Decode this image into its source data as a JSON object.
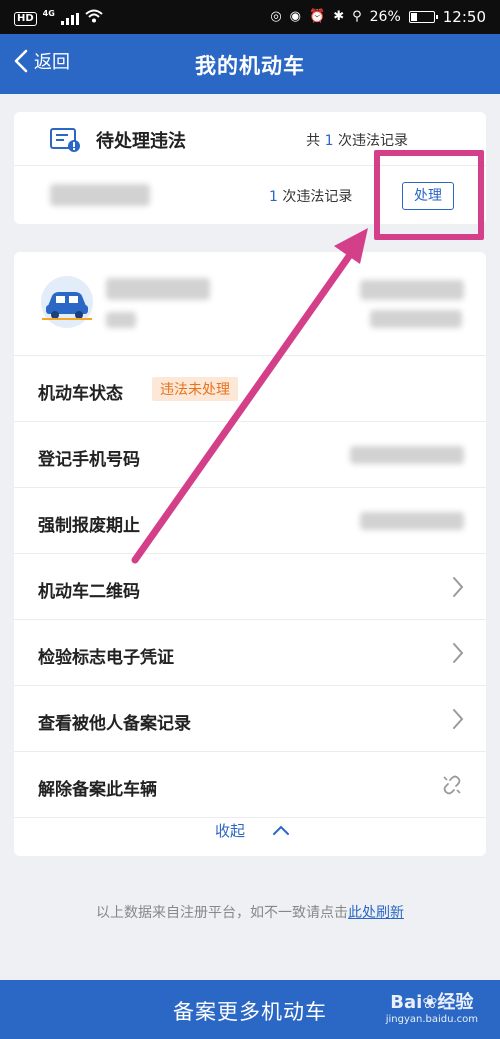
{
  "status_bar": {
    "hd": "HD",
    "network": "4G",
    "battery": "26%",
    "time": "12:50"
  },
  "nav": {
    "back_label": "返回",
    "title": "我的机动车"
  },
  "violations": {
    "title": "待处理违法",
    "total_prefix": "共",
    "total_count": "1",
    "total_suffix": "次违法记录",
    "row_count": "1",
    "row_suffix": "次违法记录",
    "handle_label": "处理"
  },
  "vehicle": {
    "status_label": "机动车状态",
    "status_tag": "违法未处理",
    "phone_label": "登记手机号码",
    "scrap_label": "强制报废期止",
    "qr_label": "机动车二维码",
    "inspection_label": "检验标志电子凭证",
    "records_label": "查看被他人备案记录",
    "unbind_label": "解除备案此车辆",
    "collapse_label": "收起"
  },
  "footer": {
    "note_prefix": "以上数据来自注册平台，如不一致请点击",
    "refresh_link": "此处刷新"
  },
  "bottom": {
    "register_more": "备案更多机动车"
  },
  "watermark": {
    "brand": "Bai",
    "brand_cn": "经验",
    "url": "jingyan.baidu.com"
  },
  "colors": {
    "primary": "#2b67c4",
    "highlight": "#d43f8a",
    "tag_bg": "#fde7d6",
    "tag_text": "#e8731e"
  }
}
